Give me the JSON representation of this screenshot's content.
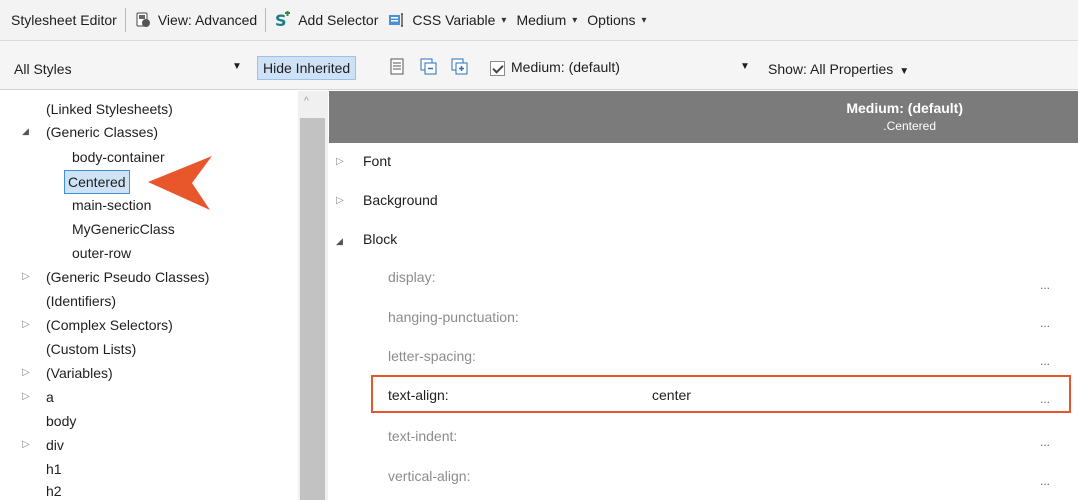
{
  "toolbar1": {
    "title": "Stylesheet Editor",
    "view": "View: Advanced",
    "add_selector": "Add Selector",
    "css_variable": "CSS Variable",
    "medium": "Medium",
    "options": "Options"
  },
  "toolbar2": {
    "styles_dropdown": "All Styles",
    "hide_inherited": "Hide Inherited",
    "medium_checkbox_label": "Medium: (default)",
    "show_dropdown": "Show: All Properties"
  },
  "tree": {
    "items": [
      {
        "label": "(Linked Stylesheets)"
      },
      {
        "label": "(Generic Classes)"
      },
      {
        "label": "body-container"
      },
      {
        "label": "Centered"
      },
      {
        "label": "main-section"
      },
      {
        "label": "MyGenericClass"
      },
      {
        "label": "outer-row"
      },
      {
        "label": "(Generic Pseudo Classes)"
      },
      {
        "label": "(Identifiers)"
      },
      {
        "label": "(Complex Selectors)"
      },
      {
        "label": "(Custom Lists)"
      },
      {
        "label": "(Variables)"
      },
      {
        "label": "a"
      },
      {
        "label": "body"
      },
      {
        "label": "div"
      },
      {
        "label": "h1"
      },
      {
        "label": "h2"
      }
    ]
  },
  "panel": {
    "header_title": "Medium: (default)",
    "header_subtitle": ".Centered",
    "groups": [
      "Font",
      "Background",
      "Block"
    ],
    "properties": [
      {
        "name": "display:",
        "value": ""
      },
      {
        "name": "hanging-punctuation:",
        "value": ""
      },
      {
        "name": "letter-spacing:",
        "value": ""
      },
      {
        "name": "text-align:",
        "value": "center"
      },
      {
        "name": "text-indent:",
        "value": ""
      },
      {
        "name": "vertical-align:",
        "value": ""
      }
    ],
    "ellipsis": "..."
  },
  "colors": {
    "callout_arrow": "#e8572b",
    "highlight_border": "#e2572d",
    "header_bg": "#7b7b7b",
    "selection_bg": "#cfe3f7"
  }
}
